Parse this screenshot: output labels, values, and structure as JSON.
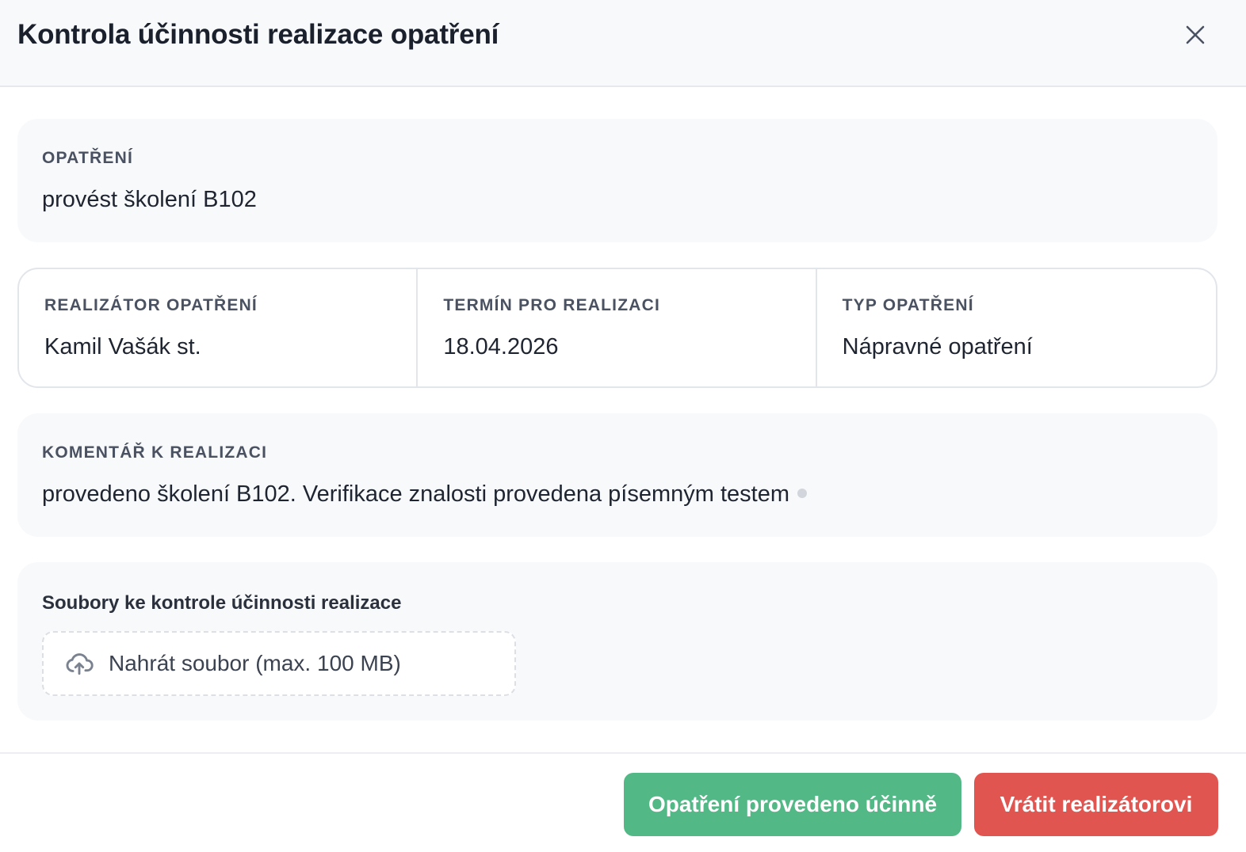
{
  "modal": {
    "title": "Kontrola účinnosti realizace opatření"
  },
  "action": {
    "label": "OPATŘENÍ",
    "value": "provést školení B102"
  },
  "info": {
    "implementer": {
      "label": "REALIZÁTOR OPATŘENÍ",
      "value": "Kamil Vašák st."
    },
    "deadline": {
      "label": "TERMÍN PRO REALIZACI",
      "value": "18.04.2026"
    },
    "type": {
      "label": "TYP OPATŘENÍ",
      "value": "Nápravné opatření"
    }
  },
  "comment": {
    "label": "KOMENTÁŘ K REALIZACI",
    "value": "provedeno školení B102. Verifikace znalosti provedena písemným testem"
  },
  "files": {
    "title": "Soubory ke kontrole účinnosti realizace",
    "upload_label": "Nahrát soubor (max. 100 MB)"
  },
  "footer": {
    "confirm_label": "Opatření provedeno účinně",
    "return_label": "Vrátit realizátorovi"
  },
  "colors": {
    "success": "#52b886",
    "danger": "#e05550",
    "card_bg": "#f8f9fb"
  },
  "icons": {
    "close": "close-icon",
    "upload": "cloud-upload-icon"
  }
}
